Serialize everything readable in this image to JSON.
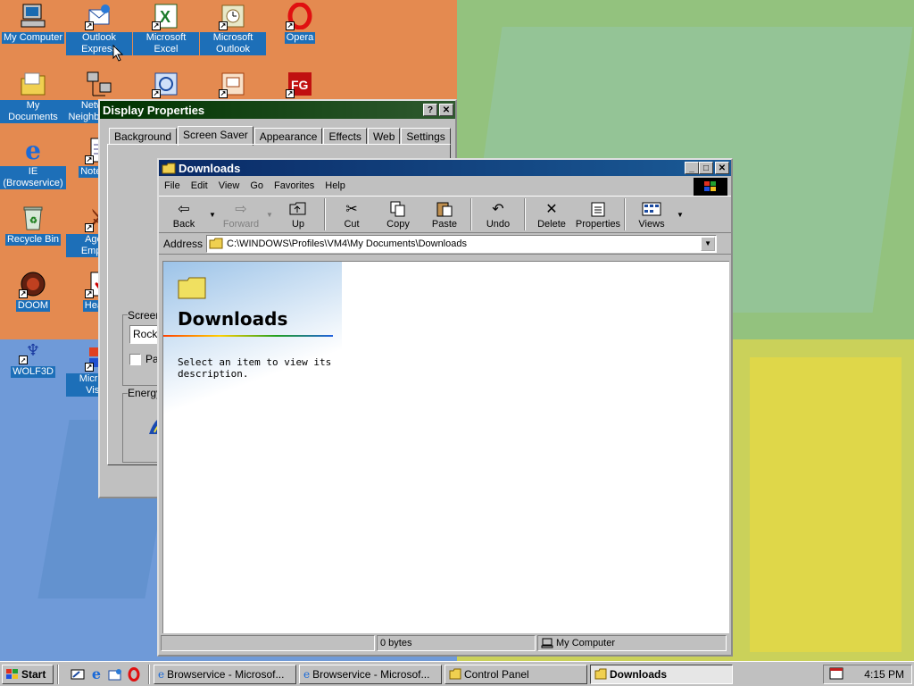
{
  "desktop": {
    "icons": [
      {
        "label": "My Computer",
        "glyph": "computer-icon"
      },
      {
        "label": "Outlook Express",
        "glyph": "outlook-express-icon"
      },
      {
        "label": "Microsoft Excel",
        "glyph": "excel-icon"
      },
      {
        "label": "Microsoft Outlook",
        "glyph": "outlook-icon"
      },
      {
        "label": "Opera",
        "glyph": "opera-icon"
      },
      {
        "label": "My Documents",
        "glyph": "documents-folder-icon"
      },
      {
        "label": "Network Neighborhood",
        "glyph": "network-icon"
      },
      {
        "label": "IE (Browservice)",
        "glyph": "ie-icon"
      },
      {
        "label": "Notepad",
        "glyph": "notepad-icon"
      },
      {
        "label": "Recycle Bin",
        "glyph": "recycle-bin-icon"
      },
      {
        "label": "Age of Empires",
        "glyph": "aoe-icon"
      },
      {
        "label": "DOOM",
        "glyph": "doom-icon"
      },
      {
        "label": "Hearts",
        "glyph": "hearts-icon"
      },
      {
        "label": "WOLF3D",
        "glyph": "wolf3d-icon"
      },
      {
        "label": "Microsoft Visual",
        "glyph": "visual-studio-icon"
      }
    ]
  },
  "display_properties": {
    "title": "Display Properties",
    "tabs": [
      "Background",
      "Screen Saver",
      "Appearance",
      "Effects",
      "Web",
      "Settings"
    ],
    "active_tab": "Screen Saver",
    "screen_saver_label": "Screen",
    "screen_saver_value": "Rock-",
    "password_label": "Pa",
    "energy_label": "Energy"
  },
  "explorer": {
    "title": "Downloads",
    "menu": [
      "File",
      "Edit",
      "View",
      "Go",
      "Favorites",
      "Help"
    ],
    "toolbar": {
      "back": "Back",
      "forward": "Forward",
      "up": "Up",
      "cut": "Cut",
      "copy": "Copy",
      "paste": "Paste",
      "undo": "Undo",
      "delete": "Delete",
      "properties": "Properties",
      "views": "Views"
    },
    "address_label": "Address",
    "address_value": "C:\\WINDOWS\\Profiles\\VM4\\My Documents\\Downloads",
    "folder_title": "Downloads",
    "description": "Select an item to view its description.",
    "status_size": "0 bytes",
    "status_zone": "My Computer"
  },
  "taskbar": {
    "start": "Start",
    "tasks": [
      {
        "label": "Browservice - Microsof...",
        "active": false
      },
      {
        "label": "Browservice - Microsof...",
        "active": false
      },
      {
        "label": "Control Panel",
        "active": false
      },
      {
        "label": "Downloads",
        "active": true
      }
    ],
    "clock": "4:15 PM"
  },
  "colors": {
    "title_active": "#0a2a66",
    "title_inactive": "#003300",
    "face": "#c0c0c0",
    "desktop_label_bg": "#1d6fb8"
  }
}
